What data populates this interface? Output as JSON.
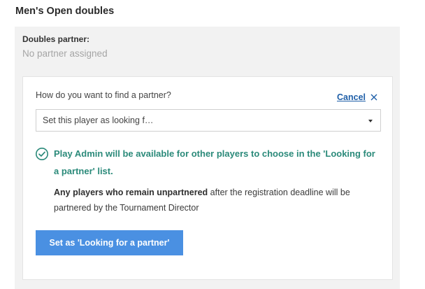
{
  "event": {
    "title": "Men's Open doubles"
  },
  "partner": {
    "label": "Doubles partner:",
    "value": "No partner assigned"
  },
  "finder": {
    "question": "How do you want to find a partner?",
    "cancel_label": "Cancel",
    "select_value": "Set this player as looking f…",
    "info_message": "Play Admin will be available for other players to choose in the 'Looking for a partner' list.",
    "note_bold": "Any players who remain unpartnered",
    "note_rest": " after the registration deadline will be partnered by the Tournament Director",
    "submit_label": "Set as 'Looking for a partner'"
  },
  "colors": {
    "accent": "#4a90e2",
    "link": "#1f5fa8",
    "success": "#2b8a7a",
    "panel_bg": "#f2f2f2"
  },
  "icons": {
    "close": "close-icon",
    "check": "check-circle-icon",
    "dropdown": "chevron-down-icon"
  }
}
